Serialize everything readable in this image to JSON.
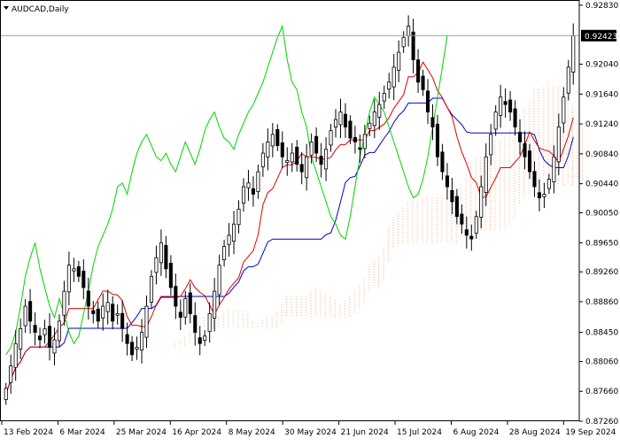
{
  "symbol_label": "AUDCAD,Daily",
  "current_price_label": "0.92423",
  "colors": {
    "background": "#ffffff",
    "frame": "#000000",
    "candle_bull": "#000000",
    "candle_bear": "#000000",
    "tenkan": "#e00000",
    "kijun": "#0000c8",
    "chikou": "#00d400",
    "kumo_bull": "#ff9a5a",
    "kumo_bear": "#d8a0e6",
    "price_line": "#a0a0a0",
    "price_tag_bg": "#000000"
  },
  "chart_data": {
    "type": "candlestick",
    "symbol": "AUDCAD",
    "timeframe": "Daily",
    "indicator": "Ichimoku Kinko Hyo",
    "ylim": [
      0.8726,
      0.929
    ],
    "y_ticks": [
      "0.92830",
      "0.92040",
      "0.91640",
      "0.91240",
      "0.90840",
      "0.90440",
      "0.90050",
      "0.89650",
      "0.89260",
      "0.88860",
      "0.88450",
      "0.88060",
      "0.87660",
      "0.87260"
    ],
    "x_labels": [
      "13 Feb 2024",
      "6 Mar 2024",
      "25 Mar 2024",
      "16 Apr 2024",
      "8 May 2024",
      "30 May 2024",
      "21 Jun 2024",
      "15 Jul 2024",
      "6 Aug 2024",
      "28 Aug 2024",
      "19 Sep 2024"
    ],
    "current_price": 0.92423,
    "close": [
      0.877,
      0.88,
      0.883,
      0.885,
      0.888,
      0.886,
      0.8845,
      0.8835,
      0.885,
      0.8825,
      0.8835,
      0.886,
      0.89,
      0.8935,
      0.893,
      0.892,
      0.8905,
      0.888,
      0.887,
      0.886,
      0.888,
      0.8885,
      0.886,
      0.887,
      0.885,
      0.883,
      0.8815,
      0.8825,
      0.8845,
      0.888,
      0.892,
      0.8945,
      0.8965,
      0.893,
      0.8905,
      0.888,
      0.8865,
      0.889,
      0.887,
      0.8845,
      0.883,
      0.884,
      0.887,
      0.89,
      0.8935,
      0.896,
      0.8975,
      0.899,
      0.901,
      0.904,
      0.9045,
      0.903,
      0.906,
      0.9085,
      0.91,
      0.911,
      0.9095,
      0.908,
      0.9075,
      0.9085,
      0.907,
      0.906,
      0.908,
      0.91,
      0.9085,
      0.907,
      0.909,
      0.9115,
      0.913,
      0.914,
      0.912,
      0.9105,
      0.91,
      0.909,
      0.911,
      0.9125,
      0.914,
      0.915,
      0.9165,
      0.918,
      0.92,
      0.922,
      0.924,
      0.9255,
      0.921,
      0.918,
      0.917,
      0.914,
      0.912,
      0.908,
      0.906,
      0.904,
      0.902,
      0.9,
      0.899,
      0.8975,
      0.897,
      0.9,
      0.904,
      0.908,
      0.911,
      0.914,
      0.916,
      0.915,
      0.914,
      0.912,
      0.91,
      0.908,
      0.906,
      0.904,
      0.9025,
      0.903,
      0.905,
      0.908,
      0.912,
      0.916,
      0.92,
      0.9242
    ]
  }
}
